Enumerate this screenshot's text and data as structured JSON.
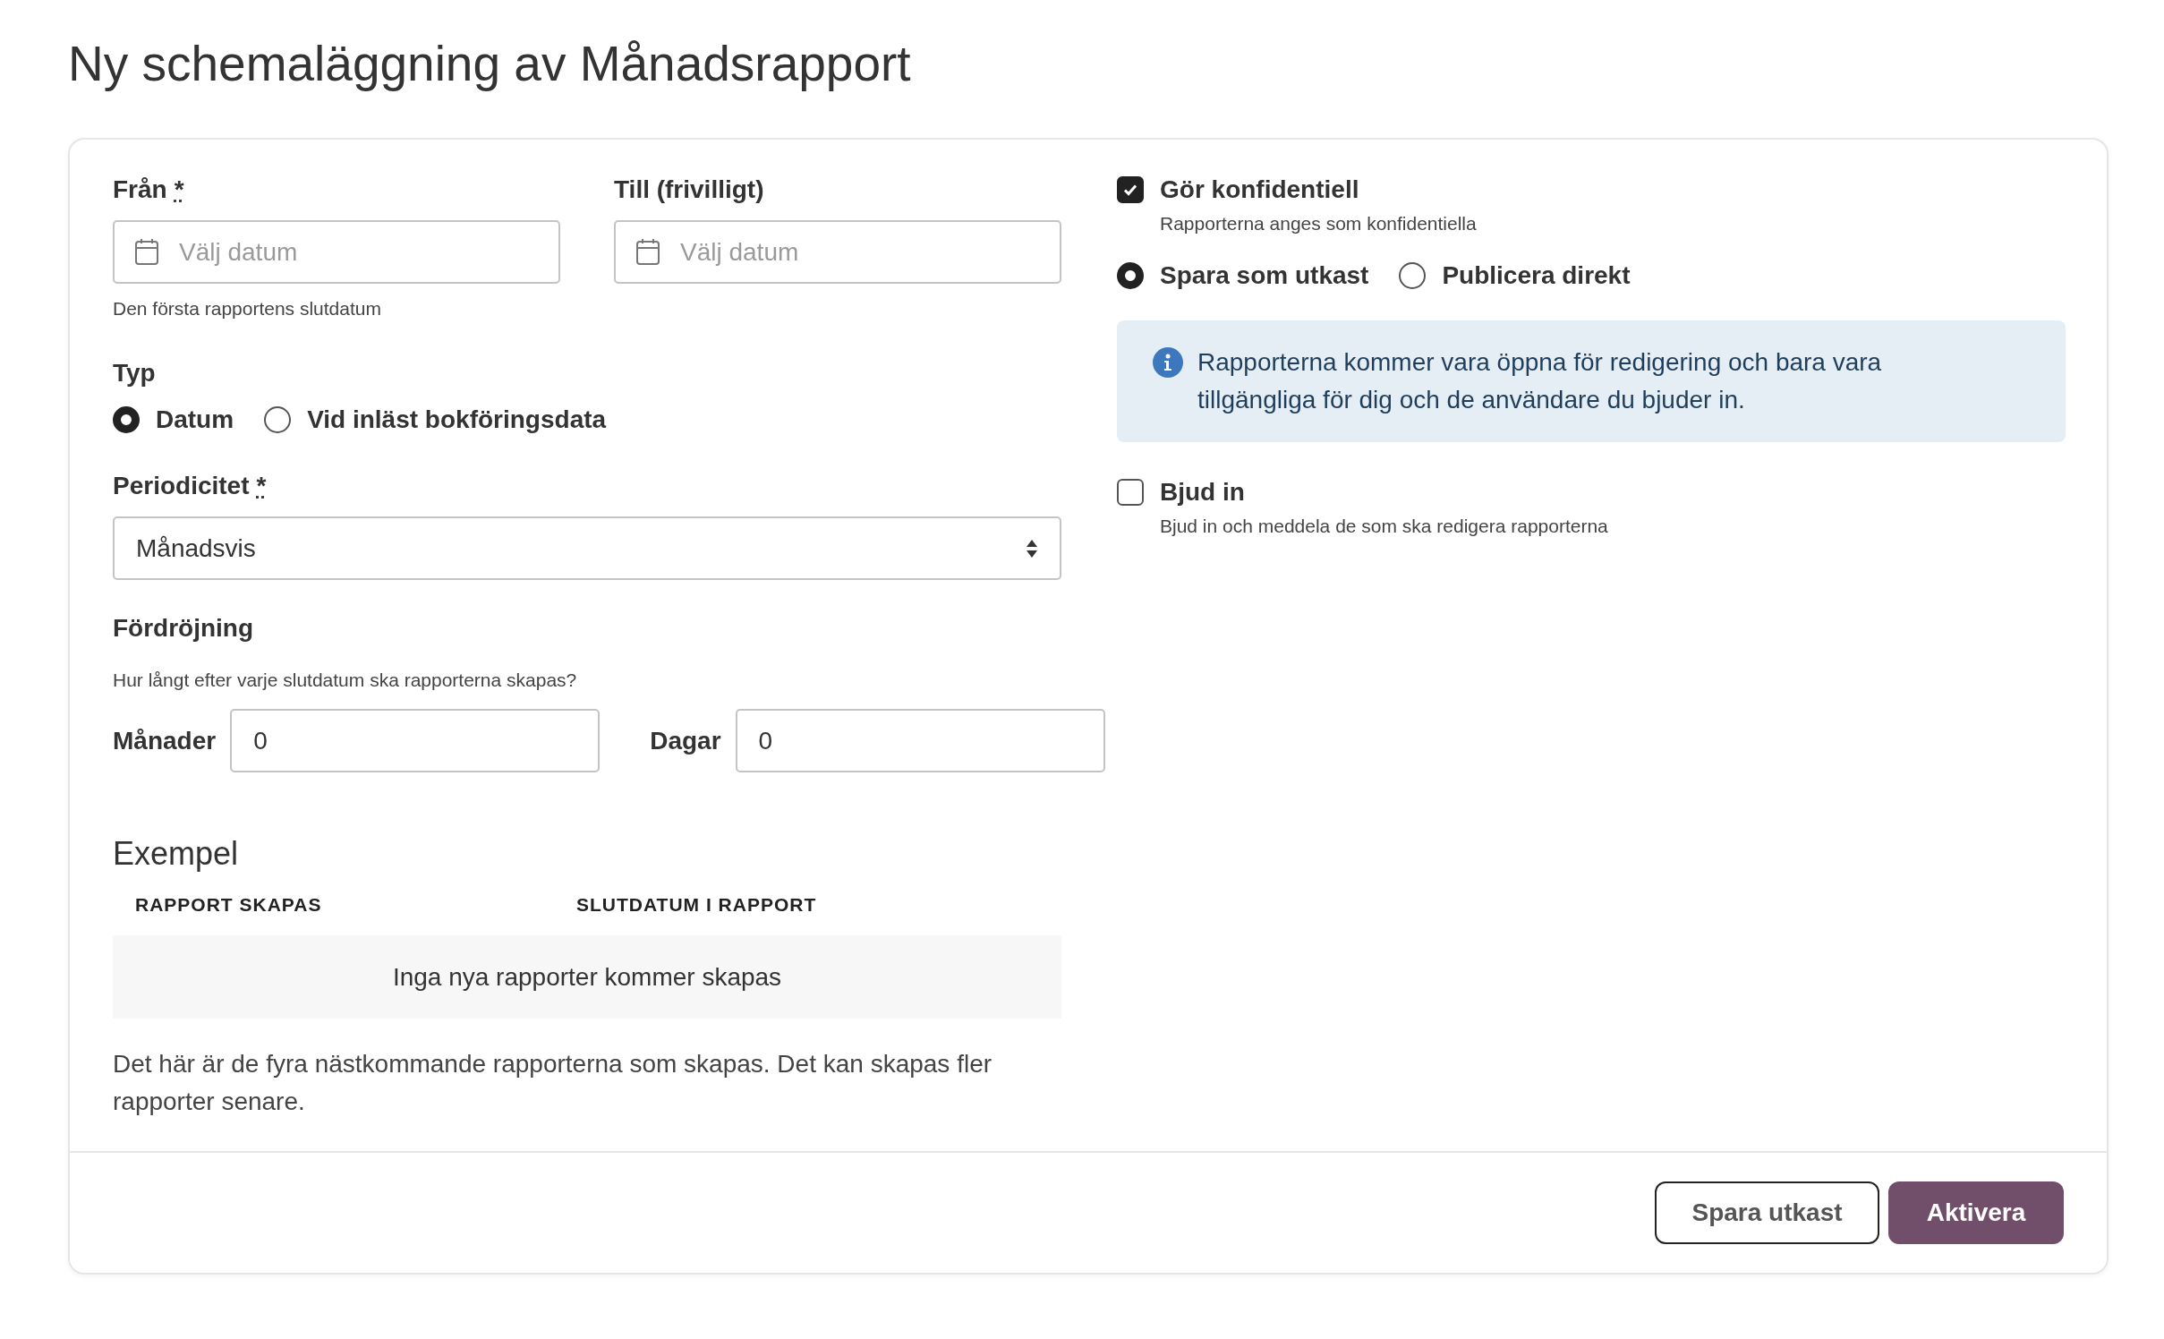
{
  "title": "Ny schemaläggning av Månadsrapport",
  "date_fields": [
    {
      "label": "Från",
      "required_mark": "*",
      "placeholder": "Välj datum",
      "help": "Den första rapportens slutdatum"
    },
    {
      "label": "Till (frivilligt)",
      "placeholder": "Välj datum"
    }
  ],
  "type": {
    "label": "Typ",
    "options": [
      {
        "label": "Datum",
        "selected": true
      },
      {
        "label": "Vid inläst bokföringsdata",
        "selected": false
      }
    ]
  },
  "periodicity": {
    "label": "Periodicitet",
    "required_mark": "*",
    "value": "Månadsvis"
  },
  "delay": {
    "label": "Fördröjning",
    "description": "Hur långt efter varje slutdatum ska rapporterna skapas?",
    "fields": [
      {
        "label": "Månader",
        "value": "0"
      },
      {
        "label": "Dagar",
        "value": "0"
      }
    ]
  },
  "example": {
    "title": "Exempel",
    "columns": [
      "RAPPORT SKAPAS",
      "SLUTDATUM I RAPPORT"
    ],
    "empty_message": "Inga nya rapporter kommer skapas",
    "note": "Det här är de fyra nästkommande rapporterna som skapas. Det kan skapas fler rapporter senare."
  },
  "confidential": {
    "label": "Gör konfidentiell",
    "description": "Rapporterna anges som konfidentiella",
    "checked": true
  },
  "publish_mode": [
    {
      "label": "Spara som utkast",
      "selected": true
    },
    {
      "label": "Publicera direkt",
      "selected": false
    }
  ],
  "info": "Rapporterna kommer vara öppna för redigering och bara vara tillgängliga för dig och de användare du bjuder in.",
  "invite": {
    "label": "Bjud in",
    "description": "Bjud in och meddela de som ska redigera rapporterna",
    "checked": false
  },
  "buttons": [
    {
      "label": "Spara utkast",
      "kind": "secondary"
    },
    {
      "label": "Aktivera",
      "kind": "primary"
    }
  ]
}
